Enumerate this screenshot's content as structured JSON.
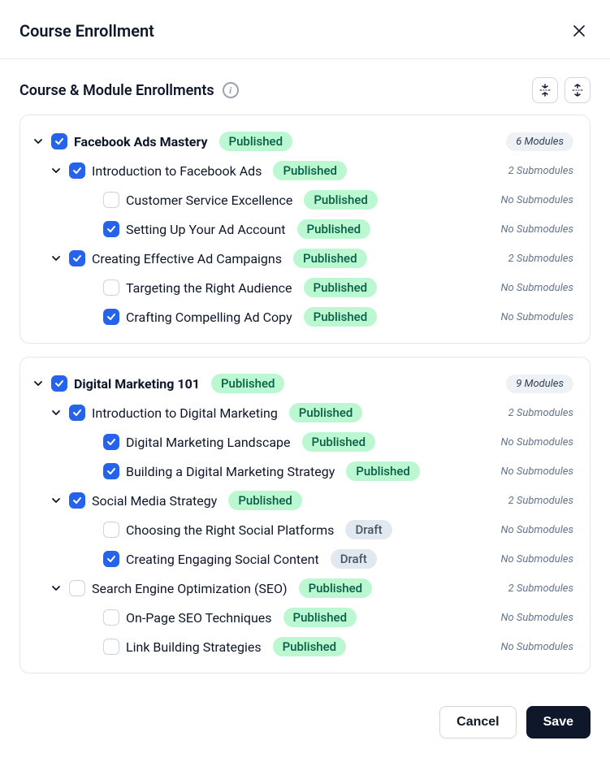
{
  "header": {
    "title": "Course Enrollment"
  },
  "section": {
    "title": "Course & Module Enrollments"
  },
  "status": {
    "published": "Published",
    "draft": "Draft"
  },
  "counts": {
    "no_submodules": "No Submodules"
  },
  "footer": {
    "cancel": "Cancel",
    "save": "Save"
  },
  "courses": [
    {
      "title": "Facebook Ads Mastery",
      "status": "published",
      "checked": true,
      "module_count_label": "6 Modules",
      "modules": [
        {
          "title": "Introduction to Facebook Ads",
          "status": "published",
          "checked": true,
          "sub_count_label": "2 Submodules",
          "subs": [
            {
              "title": "Customer Service Excellence",
              "status": "published",
              "checked": false
            },
            {
              "title": "Setting Up Your Ad Account",
              "status": "published",
              "checked": true
            }
          ]
        },
        {
          "title": "Creating Effective Ad Campaigns",
          "status": "published",
          "checked": true,
          "sub_count_label": "2 Submodules",
          "subs": [
            {
              "title": "Targeting the Right Audience",
              "status": "published",
              "checked": false
            },
            {
              "title": "Crafting Compelling Ad Copy",
              "status": "published",
              "checked": true
            }
          ]
        }
      ]
    },
    {
      "title": "Digital Marketing 101",
      "status": "published",
      "checked": true,
      "module_count_label": "9 Modules",
      "modules": [
        {
          "title": "Introduction to Digital Marketing",
          "status": "published",
          "checked": true,
          "sub_count_label": "2 Submodules",
          "subs": [
            {
              "title": "Digital Marketing Landscape",
              "status": "published",
              "checked": true
            },
            {
              "title": "Building a Digital Marketing Strategy",
              "status": "published",
              "checked": true
            }
          ]
        },
        {
          "title": "Social Media Strategy",
          "status": "published",
          "checked": true,
          "sub_count_label": "2 Submodules",
          "subs": [
            {
              "title": "Choosing the Right Social Platforms",
              "status": "draft",
              "checked": false
            },
            {
              "title": "Creating Engaging Social Content",
              "status": "draft",
              "checked": true
            }
          ]
        },
        {
          "title": "Search Engine Optimization (SEO)",
          "status": "published",
          "checked": false,
          "sub_count_label": "2 Submodules",
          "subs": [
            {
              "title": "On-Page SEO Techniques",
              "status": "published",
              "checked": false
            },
            {
              "title": "Link Building Strategies",
              "status": "published",
              "checked": false
            }
          ]
        }
      ]
    }
  ]
}
